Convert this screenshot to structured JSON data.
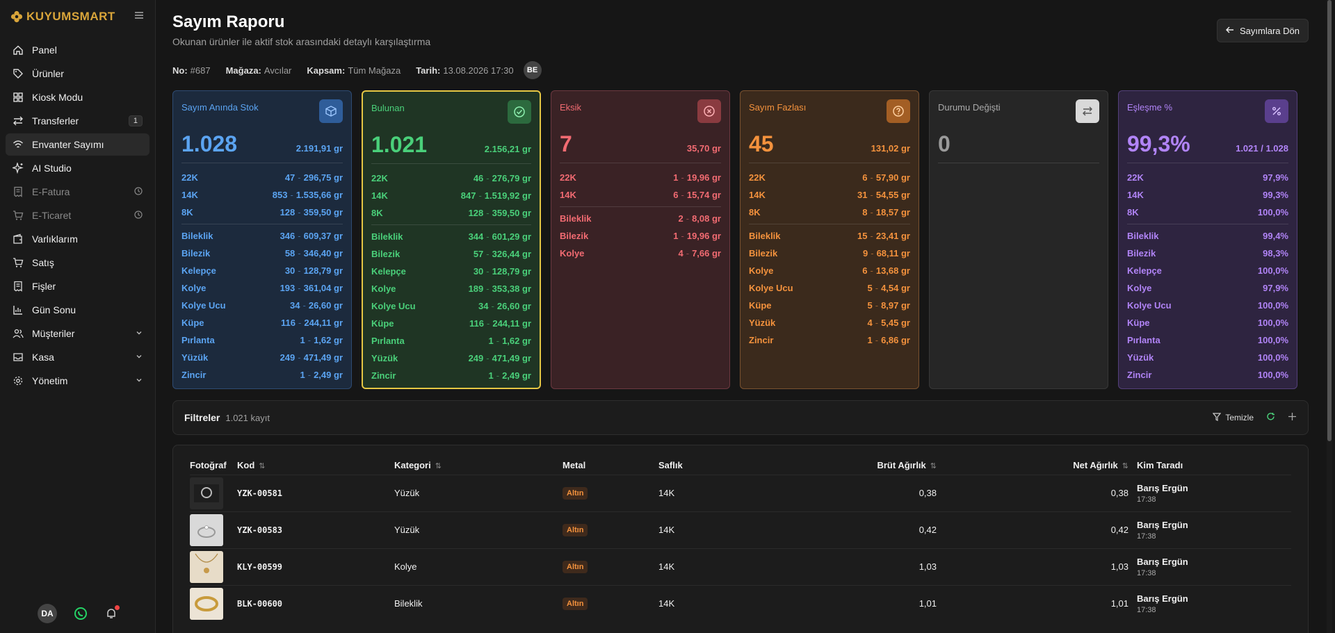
{
  "brand": {
    "name": "KUYUMSMART"
  },
  "nav": [
    {
      "id": "panel",
      "label": "Panel",
      "icon": "home-icon"
    },
    {
      "id": "urunler",
      "label": "Ürünler",
      "icon": "tag-icon"
    },
    {
      "id": "kiosk",
      "label": "Kiosk Modu",
      "icon": "grid-icon"
    },
    {
      "id": "transferler",
      "label": "Transferler",
      "icon": "transfer-icon",
      "badge": "1"
    },
    {
      "id": "envanter",
      "label": "Envanter Sayımı",
      "icon": "wifi-icon",
      "active": true
    },
    {
      "id": "ai",
      "label": "AI Studio",
      "icon": "sparkle-icon"
    },
    {
      "id": "efatura",
      "label": "E-Fatura",
      "icon": "receipt-icon",
      "muted": true,
      "clock": true
    },
    {
      "id": "eticaret",
      "label": "E-Ticaret",
      "icon": "cart-icon",
      "muted": true,
      "clock": true
    },
    {
      "id": "varliklar",
      "label": "Varlıklarım",
      "icon": "wallet-icon"
    },
    {
      "id": "satis",
      "label": "Satış",
      "icon": "cart-icon"
    },
    {
      "id": "fisler",
      "label": "Fişler",
      "icon": "receipt-icon"
    },
    {
      "id": "gunsonu",
      "label": "Gün Sonu",
      "icon": "chart-icon"
    },
    {
      "id": "musteriler",
      "label": "Müşteriler",
      "icon": "users-icon",
      "chevron": true
    },
    {
      "id": "kasa",
      "label": "Kasa",
      "icon": "inbox-icon",
      "chevron": true
    },
    {
      "id": "yonetim",
      "label": "Yönetim",
      "icon": "gear-icon",
      "chevron": true
    }
  ],
  "footer": {
    "avatar": "DA"
  },
  "header": {
    "title": "Sayım Raporu",
    "subtitle": "Okunan ürünler ile aktif stok arasındaki detaylı karşılaştırma",
    "back_label": "Sayımlara Dön"
  },
  "meta": {
    "no_label": "No:",
    "no_value": "#687",
    "magaza_label": "Mağaza:",
    "magaza_value": "Avcılar",
    "kapsam_label": "Kapsam:",
    "kapsam_value": "Tüm Mağaza",
    "tarih_label": "Tarih:",
    "tarih_value": "13.08.2026 17:30",
    "user_initials": "BE"
  },
  "cards": {
    "stok": {
      "title": "Sayım Anında Stok",
      "big": "1.028",
      "total": "2.191,91 gr",
      "karat": [
        [
          "22K",
          "47",
          "296,75 gr"
        ],
        [
          "14K",
          "853",
          "1.535,66 gr"
        ],
        [
          "8K",
          "128",
          "359,50 gr"
        ]
      ],
      "cats": [
        [
          "Bileklik",
          "346",
          "609,37 gr"
        ],
        [
          "Bilezik",
          "58",
          "346,40 gr"
        ],
        [
          "Kelepçe",
          "30",
          "128,79 gr"
        ],
        [
          "Kolye",
          "193",
          "361,04 gr"
        ],
        [
          "Kolye Ucu",
          "34",
          "26,60 gr"
        ],
        [
          "Küpe",
          "116",
          "244,11 gr"
        ],
        [
          "Pırlanta",
          "1",
          "1,62 gr"
        ],
        [
          "Yüzük",
          "249",
          "471,49 gr"
        ],
        [
          "Zincir",
          "1",
          "2,49 gr"
        ]
      ]
    },
    "bulunan": {
      "title": "Bulunan",
      "big": "1.021",
      "total": "2.156,21 gr",
      "karat": [
        [
          "22K",
          "46",
          "276,79 gr"
        ],
        [
          "14K",
          "847",
          "1.519,92 gr"
        ],
        [
          "8K",
          "128",
          "359,50 gr"
        ]
      ],
      "cats": [
        [
          "Bileklik",
          "344",
          "601,29 gr"
        ],
        [
          "Bilezik",
          "57",
          "326,44 gr"
        ],
        [
          "Kelepçe",
          "30",
          "128,79 gr"
        ],
        [
          "Kolye",
          "189",
          "353,38 gr"
        ],
        [
          "Kolye Ucu",
          "34",
          "26,60 gr"
        ],
        [
          "Küpe",
          "116",
          "244,11 gr"
        ],
        [
          "Pırlanta",
          "1",
          "1,62 gr"
        ],
        [
          "Yüzük",
          "249",
          "471,49 gr"
        ],
        [
          "Zincir",
          "1",
          "2,49 gr"
        ]
      ]
    },
    "eksik": {
      "title": "Eksik",
      "big": "7",
      "total": "35,70 gr",
      "karat": [
        [
          "22K",
          "1",
          "19,96 gr"
        ],
        [
          "14K",
          "6",
          "15,74 gr"
        ]
      ],
      "cats": [
        [
          "Bileklik",
          "2",
          "8,08 gr"
        ],
        [
          "Bilezik",
          "1",
          "19,96 gr"
        ],
        [
          "Kolye",
          "4",
          "7,66 gr"
        ]
      ]
    },
    "fazla": {
      "title": "Sayım Fazlası",
      "big": "45",
      "total": "131,02 gr",
      "karat": [
        [
          "22K",
          "6",
          "57,90 gr"
        ],
        [
          "14K",
          "31",
          "54,55 gr"
        ],
        [
          "8K",
          "8",
          "18,57 gr"
        ]
      ],
      "cats": [
        [
          "Bileklik",
          "15",
          "23,41 gr"
        ],
        [
          "Bilezik",
          "9",
          "68,11 gr"
        ],
        [
          "Kolye",
          "6",
          "13,68 gr"
        ],
        [
          "Kolye Ucu",
          "5",
          "4,54 gr"
        ],
        [
          "Küpe",
          "5",
          "8,97 gr"
        ],
        [
          "Yüzük",
          "4",
          "5,45 gr"
        ],
        [
          "Zincir",
          "1",
          "6,86 gr"
        ]
      ]
    },
    "durum": {
      "title": "Durumu Değişti",
      "big": "0"
    },
    "eslesme": {
      "title": "Eşleşme %",
      "big": "99,3%",
      "total": "1.021 / 1.028",
      "karat": [
        [
          "22K",
          "97,9%"
        ],
        [
          "14K",
          "99,3%"
        ],
        [
          "8K",
          "100,0%"
        ]
      ],
      "cats": [
        [
          "Bileklik",
          "99,4%"
        ],
        [
          "Bilezik",
          "98,3%"
        ],
        [
          "Kelepçe",
          "100,0%"
        ],
        [
          "Kolye",
          "97,9%"
        ],
        [
          "Kolye Ucu",
          "100,0%"
        ],
        [
          "Küpe",
          "100,0%"
        ],
        [
          "Pırlanta",
          "100,0%"
        ],
        [
          "Yüzük",
          "100,0%"
        ],
        [
          "Zincir",
          "100,0%"
        ]
      ]
    }
  },
  "filters": {
    "title": "Filtreler",
    "count": "1.021 kayıt",
    "clear_label": "Temizle"
  },
  "table": {
    "columns": {
      "foto": "Fotoğraf",
      "kod": "Kod",
      "kategori": "Kategori",
      "metal": "Metal",
      "saflik": "Saflık",
      "brut": "Brüt Ağırlık",
      "net": "Net Ağırlık",
      "kim": "Kim Taradı"
    },
    "rows": [
      {
        "kod": "YZK-00581",
        "kategori": "Yüzük",
        "metal": "Altın",
        "saflik": "14K",
        "brut": "0,38",
        "net": "0,38",
        "kim": "Barış Ergün",
        "saat": "17:38"
      },
      {
        "kod": "YZK-00583",
        "kategori": "Yüzük",
        "metal": "Altın",
        "saflik": "14K",
        "brut": "0,42",
        "net": "0,42",
        "kim": "Barış Ergün",
        "saat": "17:38"
      },
      {
        "kod": "KLY-00599",
        "kategori": "Kolye",
        "metal": "Altın",
        "saflik": "14K",
        "brut": "1,03",
        "net": "1,03",
        "kim": "Barış Ergün",
        "saat": "17:38"
      },
      {
        "kod": "BLK-00600",
        "kategori": "Bileklik",
        "metal": "Altın",
        "saflik": "14K",
        "brut": "1,01",
        "net": "1,01",
        "kim": "Barış Ergün",
        "saat": "17:38"
      }
    ]
  }
}
